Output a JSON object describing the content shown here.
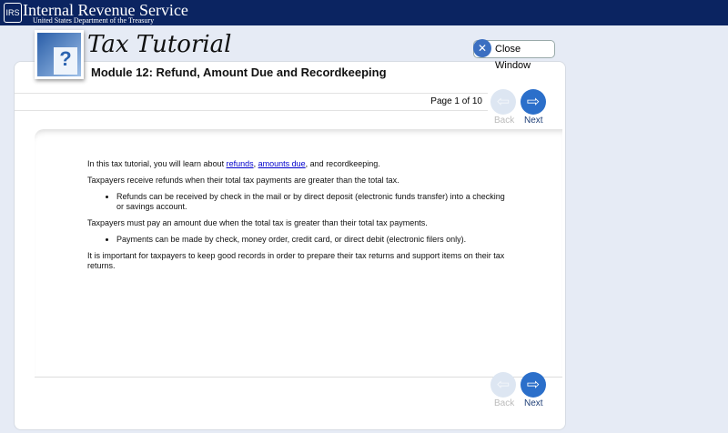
{
  "header": {
    "org": "Internal Revenue Service",
    "sub": "United States Department of the Treasury",
    "seal": "IRS"
  },
  "app_title": "Tax Tutorial",
  "logo_glyph": "?",
  "module_title": "Module 12: Refund, Amount Due and Recordkeeping",
  "close_label": "Close Window",
  "page_indicator": "Page 1 of 10",
  "nav": {
    "back": "Back",
    "next": "Next"
  },
  "content": {
    "intro_pre": "In this tax tutorial, you will learn about ",
    "link1": "refunds",
    "sep": ", ",
    "link2": "amounts due",
    "intro_post": ", and recordkeeping.",
    "p1": "Taxpayers receive refunds when their total tax payments are greater than the total tax.",
    "b1": "Refunds can be received by check in the mail or by direct deposit (electronic funds transfer) into a checking or savings account.",
    "p2": "Taxpayers must pay an amount due when the total tax is greater than their total tax payments.",
    "b2": "Payments can be made by check, money order, credit card, or direct debit (electronic filers only).",
    "p3": "It is important for taxpayers to keep good records in order to prepare their tax returns and support items on their tax returns."
  }
}
